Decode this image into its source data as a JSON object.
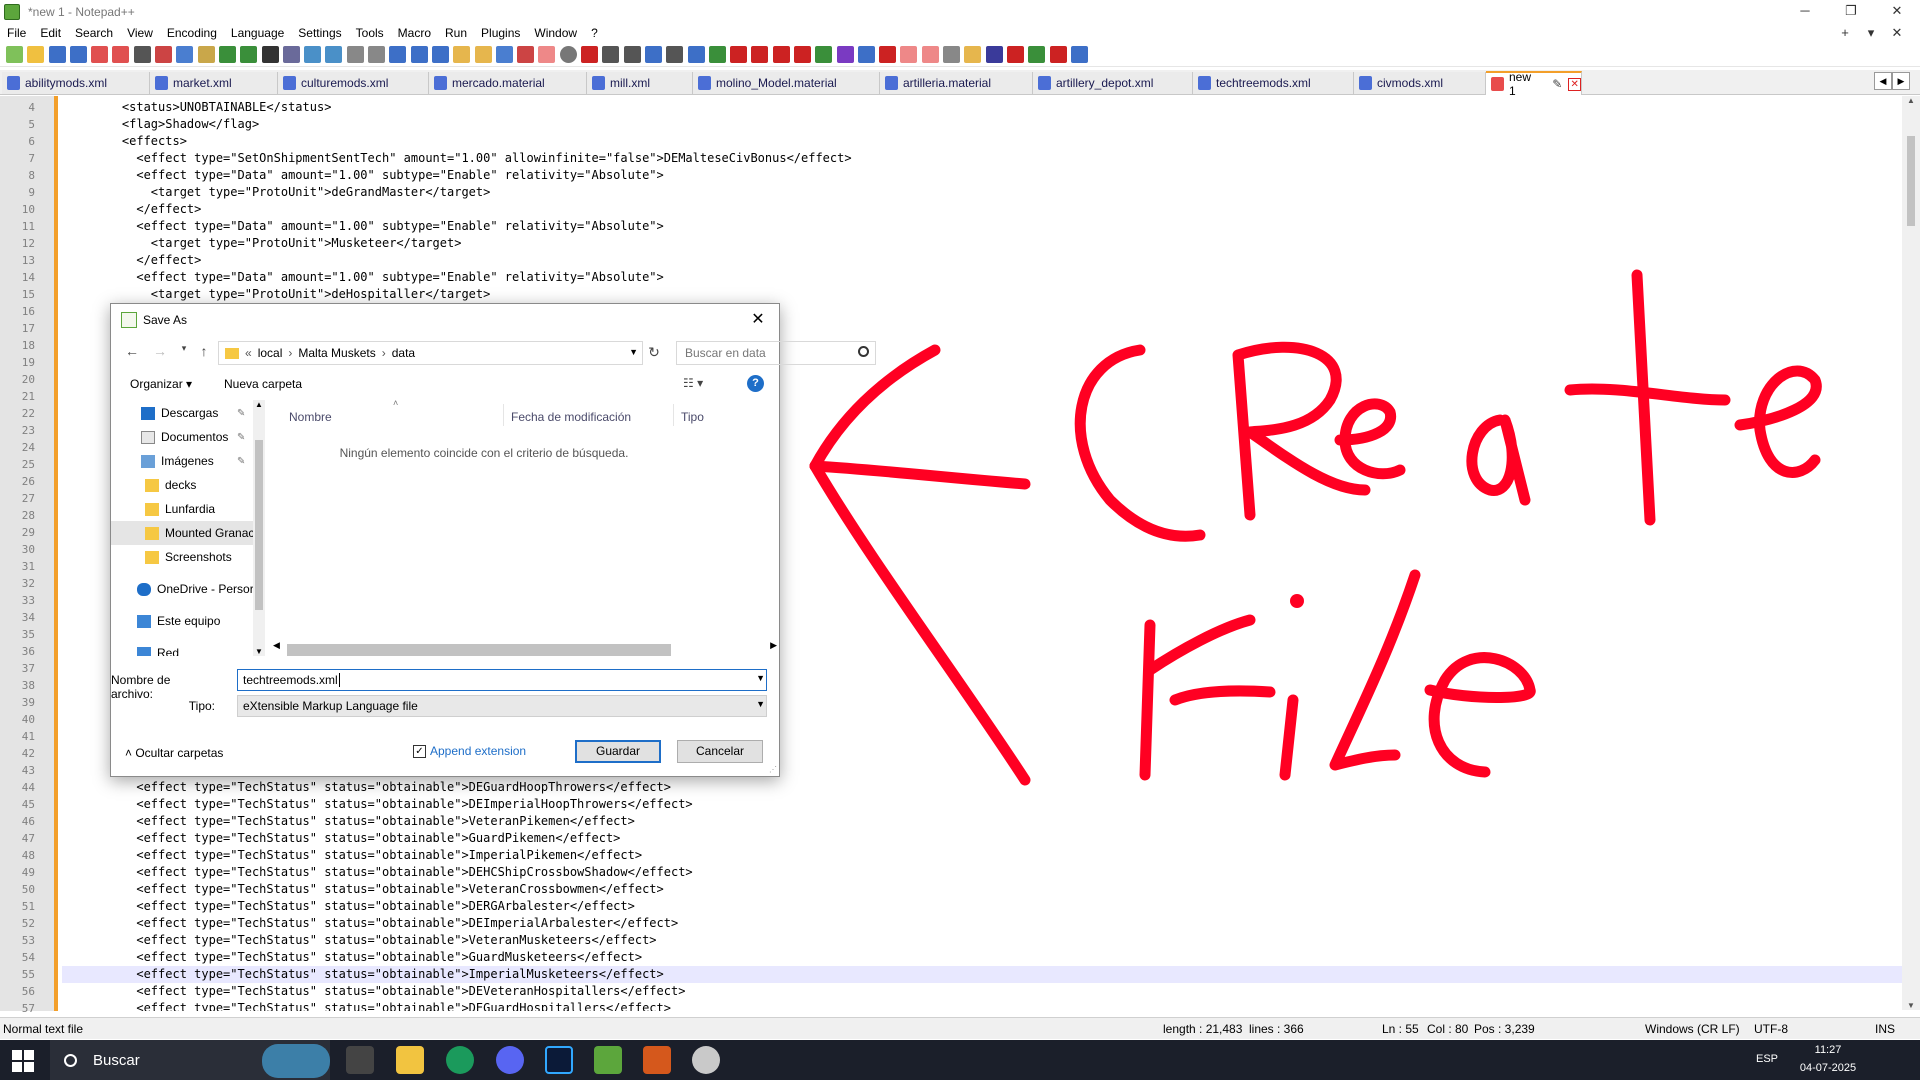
{
  "window": {
    "title": "*new 1 - Notepad++",
    "controls": [
      "─",
      "❐",
      "✕"
    ]
  },
  "menu": {
    "items": [
      "File",
      "Edit",
      "Search",
      "View",
      "Encoding",
      "Language",
      "Settings",
      "Tools",
      "Macro",
      "Run",
      "Plugins",
      "Window",
      "?"
    ],
    "right": [
      "+",
      "▾",
      "✕"
    ]
  },
  "tabs": [
    {
      "label": "abilitymods.xml"
    },
    {
      "label": "market.xml"
    },
    {
      "label": "culturemods.xml"
    },
    {
      "label": "mercado.material"
    },
    {
      "label": "mill.xml"
    },
    {
      "label": "molino_Model.material"
    },
    {
      "label": "artilleria.material"
    },
    {
      "label": "artillery_depot.xml"
    },
    {
      "label": "techtreemods.xml"
    },
    {
      "label": "civmods.xml"
    },
    {
      "label": "new 1",
      "active": true
    }
  ],
  "editor": {
    "current_line": 55,
    "lines": [
      {
        "n": "4",
        "t": "    <status>UNOBTAINABLE</status>"
      },
      {
        "n": "5",
        "t": "    <flag>Shadow</flag>"
      },
      {
        "n": "6",
        "t": "    <effects>"
      },
      {
        "n": "7",
        "t": "      <effect type=\"SetOnShipmentSentTech\" amount=\"1.00\" allowinfinite=\"false\">DEMalteseCivBonus</effect>"
      },
      {
        "n": "8",
        "t": "      <effect type=\"Data\" amount=\"1.00\" subtype=\"Enable\" relativity=\"Absolute\">"
      },
      {
        "n": "9",
        "t": "        <target type=\"ProtoUnit\">deGrandMaster</target>"
      },
      {
        "n": "10",
        "t": "      </effect>"
      },
      {
        "n": "11",
        "t": "      <effect type=\"Data\" amount=\"1.00\" subtype=\"Enable\" relativity=\"Absolute\">"
      },
      {
        "n": "12",
        "t": "        <target type=\"ProtoUnit\">Musketeer</target>"
      },
      {
        "n": "13",
        "t": "      </effect>"
      },
      {
        "n": "14",
        "t": "      <effect type=\"Data\" amount=\"1.00\" subtype=\"Enable\" relativity=\"Absolute\">"
      },
      {
        "n": "15",
        "t": "        <target type=\"ProtoUnit\">deHospitaller</target>"
      },
      {
        "n": "16",
        "t": ""
      },
      {
        "n": "17",
        "t": ""
      },
      {
        "n": "18",
        "t": ""
      },
      {
        "n": "19",
        "t": ""
      },
      {
        "n": "20",
        "t": ""
      },
      {
        "n": "21",
        "t": ""
      },
      {
        "n": "22",
        "t": ""
      },
      {
        "n": "23",
        "t": ""
      },
      {
        "n": "24",
        "t": ""
      },
      {
        "n": "25",
        "t": ""
      },
      {
        "n": "26",
        "t": ""
      },
      {
        "n": "27",
        "t": ""
      },
      {
        "n": "28",
        "t": ""
      },
      {
        "n": "29",
        "t": ""
      },
      {
        "n": "30",
        "t": ""
      },
      {
        "n": "31",
        "t": ""
      },
      {
        "n": "32",
        "t": ""
      },
      {
        "n": "33",
        "t": ""
      },
      {
        "n": "34",
        "t": ""
      },
      {
        "n": "35",
        "t": ""
      },
      {
        "n": "36",
        "t": ""
      },
      {
        "n": "37",
        "t": ""
      },
      {
        "n": "38",
        "t": ""
      },
      {
        "n": "39",
        "t": ""
      },
      {
        "n": "40",
        "t": ""
      },
      {
        "n": "41",
        "t": ""
      },
      {
        "n": "42",
        "t": ""
      },
      {
        "n": "43",
        "t": ""
      },
      {
        "n": "44",
        "t": "      <effect type=\"TechStatus\" status=\"obtainable\">DEGuardHoopThrowers</effect>"
      },
      {
        "n": "45",
        "t": "      <effect type=\"TechStatus\" status=\"obtainable\">DEImperialHoopThrowers</effect>"
      },
      {
        "n": "46",
        "t": "      <effect type=\"TechStatus\" status=\"obtainable\">VeteranPikemen</effect>"
      },
      {
        "n": "47",
        "t": "      <effect type=\"TechStatus\" status=\"obtainable\">GuardPikemen</effect>"
      },
      {
        "n": "48",
        "t": "      <effect type=\"TechStatus\" status=\"obtainable\">ImperialPikemen</effect>"
      },
      {
        "n": "49",
        "t": "      <effect type=\"TechStatus\" status=\"obtainable\">DEHCShipCrossbowShadow</effect>"
      },
      {
        "n": "50",
        "t": "      <effect type=\"TechStatus\" status=\"obtainable\">VeteranCrossbowmen</effect>"
      },
      {
        "n": "51",
        "t": "      <effect type=\"TechStatus\" status=\"obtainable\">DERGArbalester</effect>"
      },
      {
        "n": "52",
        "t": "      <effect type=\"TechStatus\" status=\"obtainable\">DEImperialArbalester</effect>"
      },
      {
        "n": "53",
        "t": "      <effect type=\"TechStatus\" status=\"obtainable\">VeteranMusketeers</effect>"
      },
      {
        "n": "54",
        "t": "      <effect type=\"TechStatus\" status=\"obtainable\">GuardMusketeers</effect>"
      },
      {
        "n": "55",
        "t": "      <effect type=\"TechStatus\" status=\"obtainable\">ImperialMusketeers</effect>"
      },
      {
        "n": "56",
        "t": "      <effect type=\"TechStatus\" status=\"obtainable\">DEVeteranHospitallers</effect>"
      },
      {
        "n": "57",
        "t": "      <effect type=\"TechStatus\" status=\"obtainable\">DEGuardHospitallers</effect>"
      }
    ]
  },
  "status": {
    "type": "Normal text file",
    "length": "length : 21,483",
    "lines": "lines : 366",
    "ln": "Ln : 55",
    "col": "Col : 80",
    "pos": "Pos : 3,239",
    "eol": "Windows (CR LF)",
    "enc": "UTF-8",
    "ins": "INS"
  },
  "dialog": {
    "title": "Save As",
    "breadcrumb": [
      "«",
      "local",
      "Malta Muskets",
      "data"
    ],
    "search_placeholder": "Buscar en data",
    "organize": "Organizar ▾",
    "new_folder": "Nueva carpeta",
    "nav": [
      {
        "label": "Descargas",
        "icon": "download-icon",
        "pinned": true
      },
      {
        "label": "Documentos",
        "icon": "documents-icon",
        "pinned": true
      },
      {
        "label": "Imágenes",
        "icon": "pictures-icon",
        "pinned": true
      },
      {
        "label": "decks",
        "icon": "folder-icon"
      },
      {
        "label": "Lunfardia",
        "icon": "folder-icon"
      },
      {
        "label": "Mounted Granac",
        "icon": "folder-icon",
        "selected": true
      },
      {
        "label": "Screenshots",
        "icon": "folder-icon"
      },
      {
        "label": "OneDrive - Persor",
        "icon": "onedrive-icon"
      },
      {
        "label": "Este equipo",
        "icon": "computer-icon"
      },
      {
        "label": "Red",
        "icon": "network-icon"
      }
    ],
    "columns": [
      "Nombre",
      "Fecha de modificación",
      "Tipo"
    ],
    "empty_message": "Ningún elemento coincide con el criterio de búsqueda.",
    "filename_label": "Nombre de archivo:",
    "filename_value": "techtreemods.xml",
    "type_label": "Tipo:",
    "type_value": "eXtensible Markup Language file",
    "hide_folders": "Ocultar carpetas",
    "append_extension": "Append extension",
    "append_checked": true,
    "save_button": "Guardar",
    "cancel_button": "Cancelar"
  },
  "annotation": {
    "text_line1": "Create",
    "text_line2": "File",
    "color": "#ff0022"
  },
  "taskbar": {
    "search_label": "Buscar",
    "lang": "ESP",
    "time": "11:27",
    "date": "04-07-2025"
  },
  "colors": {
    "accent": "#f39f2a",
    "tab_icon": "#4b6ed6",
    "annotation": "#ff0022"
  }
}
